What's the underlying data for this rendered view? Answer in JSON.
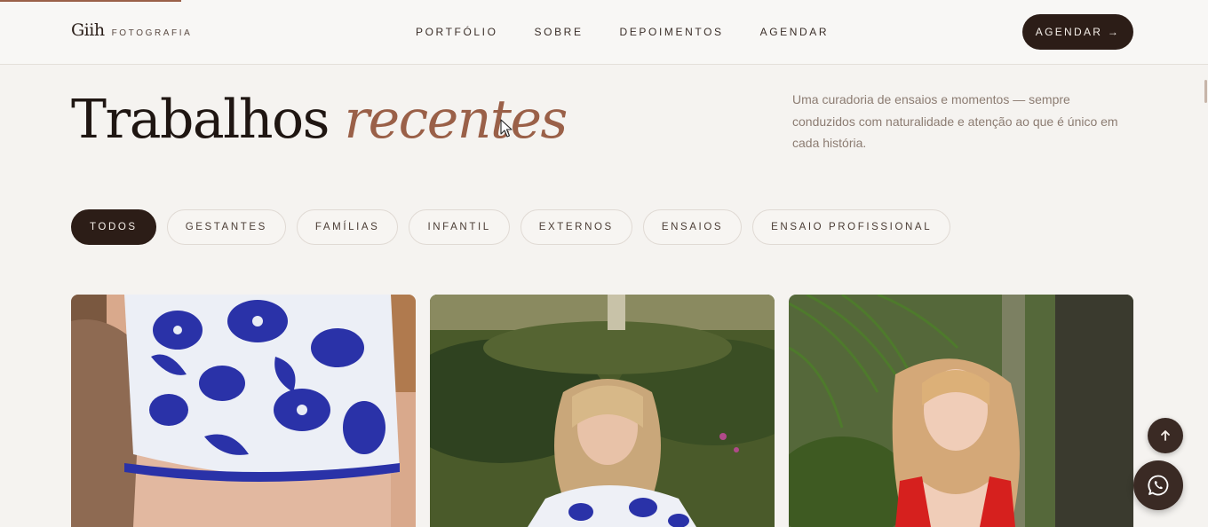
{
  "header": {
    "brand_name": "Giih",
    "brand_sub": "FOTOGRAFIA",
    "nav": [
      {
        "label": "PORTFÓLIO"
      },
      {
        "label": "SOBRE"
      },
      {
        "label": "DEPOIMENTOS"
      },
      {
        "label": "AGENDAR"
      }
    ],
    "cta_label": "AGENDAR →"
  },
  "scroll_progress": 0.15,
  "section": {
    "title_plain": "Trabalhos",
    "title_accent": "recentes",
    "description": "Uma curadoria de ensaios e momentos — sempre conduzidos com naturalidade e atenção ao que é único em cada história."
  },
  "filters": [
    {
      "label": "TODOS",
      "active": true
    },
    {
      "label": "GESTANTES",
      "active": false
    },
    {
      "label": "FAMÍLIAS",
      "active": false
    },
    {
      "label": "INFANTIL",
      "active": false
    },
    {
      "label": "EXTERNOS",
      "active": false
    },
    {
      "label": "ENSAIOS",
      "active": false
    },
    {
      "label": "ENSAIO PROFISSIONAL",
      "active": false
    }
  ],
  "gallery": [
    {
      "icon": "photo-floral-top"
    },
    {
      "icon": "photo-girl-garden"
    },
    {
      "icon": "photo-girl-red-dress"
    }
  ],
  "floating": {
    "back_to_top_icon": "arrow-up-icon",
    "whatsapp_icon": "whatsapp-icon"
  },
  "colors": {
    "accent": "#9a6048",
    "dark": "#2c1d17",
    "background": "#f5f3f0"
  }
}
